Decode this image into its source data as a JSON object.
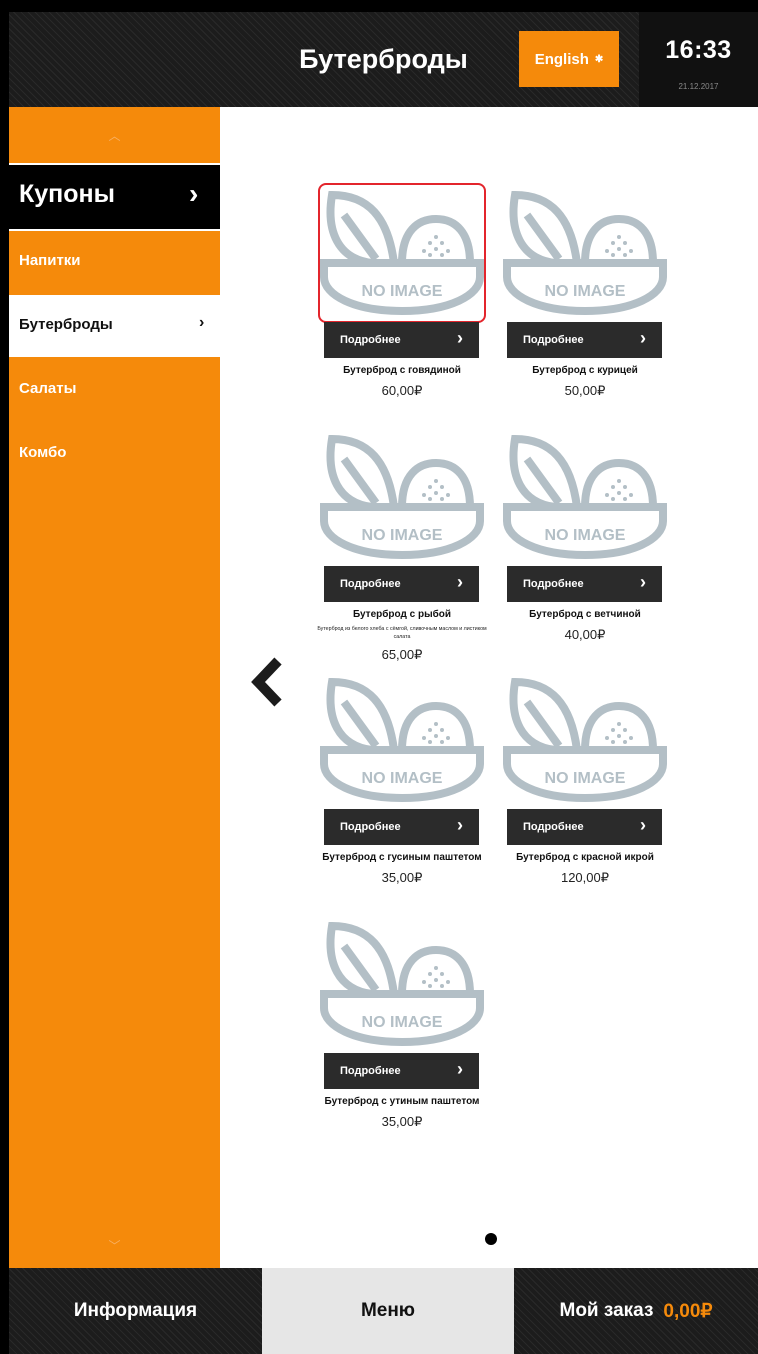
{
  "header": {
    "title": "Бутерброды",
    "language_label": "English",
    "flag_icon": "uk-flag-icon",
    "time": "16:33",
    "date": "21.12.2017"
  },
  "sidebar": {
    "coupons_label": "Купоны",
    "items": [
      {
        "label": "Напитки",
        "active": false
      },
      {
        "label": "Бутерброды",
        "active": true
      },
      {
        "label": "Салаты",
        "active": false
      },
      {
        "label": "Комбо",
        "active": false
      }
    ]
  },
  "products": [
    {
      "name": "Бутерброд с говядиной",
      "price": "60,00₽",
      "description": "",
      "image_text": "NO IMAGE",
      "details_label": "Подробнее"
    },
    {
      "name": "Бутерброд с курицей",
      "price": "50,00₽",
      "description": "",
      "image_text": "NO IMAGE",
      "details_label": "Подробнее"
    },
    {
      "name": "Бутерброд с рыбой",
      "price": "65,00₽",
      "description": "Бутерброд из белого хлеба с сёмгой, сливочным маслом и листиком салата",
      "image_text": "NO IMAGE",
      "details_label": "Подробнее"
    },
    {
      "name": "Бутерброд с ветчиной",
      "price": "40,00₽",
      "description": "",
      "image_text": "NO IMAGE",
      "details_label": "Подробнее"
    },
    {
      "name": "Бутерброд с гусиным паштетом",
      "price": "35,00₽",
      "description": "",
      "image_text": "NO IMAGE",
      "details_label": "Подробнее"
    },
    {
      "name": "Бутерброд с красной икрой",
      "price": "120,00₽",
      "description": "",
      "image_text": "NO IMAGE",
      "details_label": "Подробнее"
    },
    {
      "name": "Бутерброд с утиным паштетом",
      "price": "35,00₽",
      "description": "",
      "image_text": "NO IMAGE",
      "details_label": "Подробнее"
    }
  ],
  "footer": {
    "info_label": "Информация",
    "menu_label": "Меню",
    "order_label": "Мой заказ",
    "order_total": "0,00₽"
  },
  "colors": {
    "accent": "#f58a0b",
    "dark": "#1c1c1c",
    "placeholder": "#b3bfc6",
    "selection": "#e3252c"
  }
}
